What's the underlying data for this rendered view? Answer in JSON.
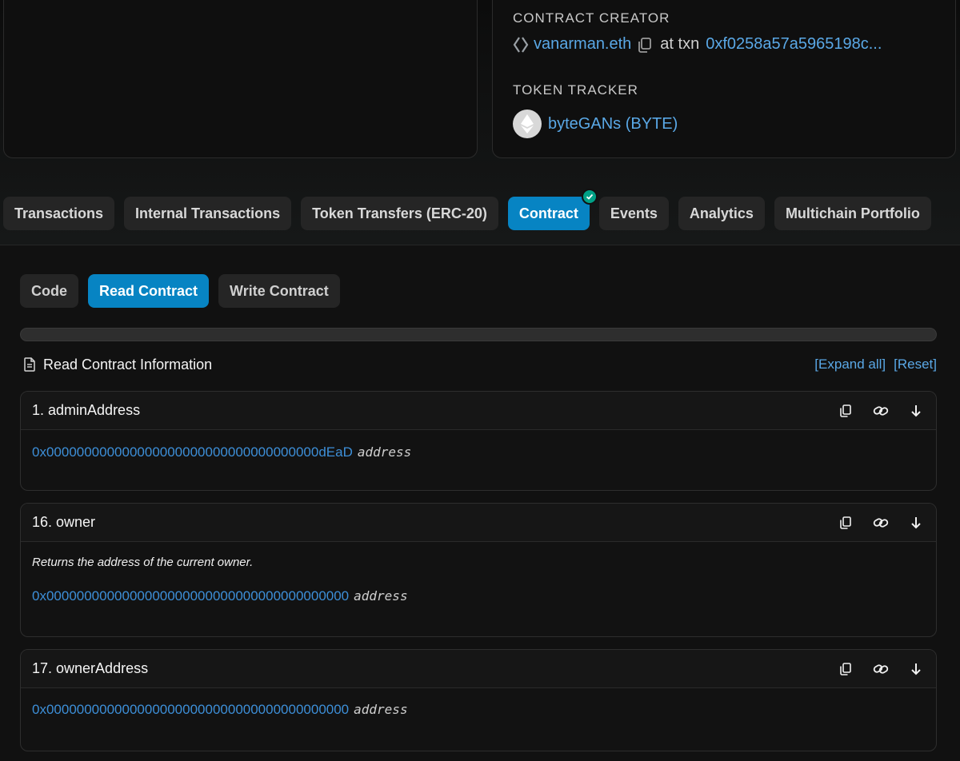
{
  "contract_creator": {
    "label": "CONTRACT CREATOR",
    "creator": "vanarman.eth",
    "at_txn_label": "at txn",
    "txn_hash": "0xf0258a57a5965198c..."
  },
  "token_tracker": {
    "label": "TOKEN TRACKER",
    "token": "byteGANs (BYTE)"
  },
  "tabs": [
    {
      "label": "Transactions",
      "active": false
    },
    {
      "label": "Internal Transactions",
      "active": false
    },
    {
      "label": "Token Transfers (ERC-20)",
      "active": false
    },
    {
      "label": "Contract",
      "active": true,
      "verified": true
    },
    {
      "label": "Events",
      "active": false
    },
    {
      "label": "Analytics",
      "active": false
    },
    {
      "label": "Multichain Portfolio",
      "active": false
    }
  ],
  "subtabs": [
    {
      "label": "Code",
      "active": false
    },
    {
      "label": "Read Contract",
      "active": true
    },
    {
      "label": "Write Contract",
      "active": false
    }
  ],
  "read_info": {
    "title": "Read Contract Information",
    "expand_all": "[Expand all]",
    "reset": "[Reset]"
  },
  "functions": [
    {
      "title": "1. adminAddress",
      "description": "",
      "value": "0x000000000000000000000000000000000000dEaD",
      "type": "address"
    },
    {
      "title": "16. owner",
      "description": "Returns the address of the current owner.",
      "value": "0x0000000000000000000000000000000000000000",
      "type": "address"
    },
    {
      "title": "17. ownerAddress",
      "description": "",
      "value": "0x0000000000000000000000000000000000000000",
      "type": "address"
    }
  ],
  "icons": {
    "creator": "ens-avatar-icon",
    "copy": "copy-icon",
    "token": "ethereum-icon",
    "info": "document-icon",
    "link": "link-icon",
    "expand": "arrow-down-icon",
    "verified": "check-icon"
  },
  "colors": {
    "accent": "#0784c3",
    "link": "#5aa8e6",
    "verified": "#00a186",
    "background": "#111111"
  }
}
